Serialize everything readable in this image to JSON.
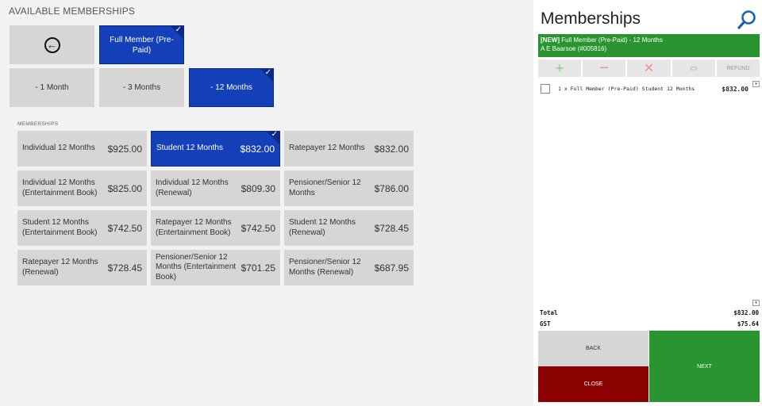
{
  "left": {
    "heading": "AVAILABLE MEMBERSHIPS",
    "categories": [
      {
        "label": "Full Member (Pre-Paid)",
        "selected": true
      }
    ],
    "durations": [
      {
        "label": "- 1 Month",
        "selected": false
      },
      {
        "label": "- 3 Months",
        "selected": false
      },
      {
        "label": "- 12 Months",
        "selected": true
      }
    ],
    "section_label": "MEMBERSHIPS",
    "memberships": [
      {
        "name": "Individual 12 Months",
        "price": "$925.00",
        "selected": false
      },
      {
        "name": "Student 12 Months",
        "price": "$832.00",
        "selected": true
      },
      {
        "name": "Ratepayer 12 Months",
        "price": "$832.00",
        "selected": false
      },
      {
        "name": "Individual 12 Months (Entertainment Book)",
        "price": "$825.00",
        "selected": false
      },
      {
        "name": "Individual 12 Months (Renewal)",
        "price": "$809.30",
        "selected": false
      },
      {
        "name": "Pensioner/Senior  12 Months",
        "price": "$786.00",
        "selected": false
      },
      {
        "name": "Student 12 Months (Entertainment Book)",
        "price": "$742.50",
        "selected": false
      },
      {
        "name": "Ratepayer 12 Months (Entertainment Book)",
        "price": "$742.50",
        "selected": false
      },
      {
        "name": "Student 12 Months (Renewal)",
        "price": "$728.45",
        "selected": false
      },
      {
        "name": "Ratepayer 12 Months (Renewal)",
        "price": "$728.45",
        "selected": false
      },
      {
        "name": "Pensioner/Senior 12 Months (Entertainment Book)",
        "price": "$701.25",
        "selected": false
      },
      {
        "name": "Pensioner/Senior 12 Months (Renewal)",
        "price": "$687.95",
        "selected": false
      }
    ],
    "back_icon": "arrow-left-circle-icon",
    "check_glyph": "✓"
  },
  "right": {
    "title": "Memberships",
    "search_icon": "search-icon",
    "banner": {
      "tag": "[NEW]",
      "line1": " Full Member (Pre-Paid) - 12 Months",
      "line2": "A E Baarsoe (#005816)"
    },
    "toolbar": {
      "add": "+",
      "minus": "−",
      "remove": "✕",
      "split": "▭",
      "refund": "REFUND"
    },
    "line_items": [
      {
        "desc": "1 x Full Member (Pre-Paid) Student 12 Months",
        "amount": "$832.00"
      }
    ],
    "collapse_glyph": "▾",
    "totals": [
      {
        "label": "Total",
        "value": "$832.00"
      },
      {
        "label": "GST",
        "value": "$75.64"
      }
    ],
    "buttons": {
      "back": "BACK",
      "close": "CLOSE",
      "next": "NEXT"
    }
  },
  "colors": {
    "selected_tile": "#1440b9",
    "green": "#2a9530",
    "close_red": "#8b0000",
    "tile_grey": "#d6d6d6"
  }
}
